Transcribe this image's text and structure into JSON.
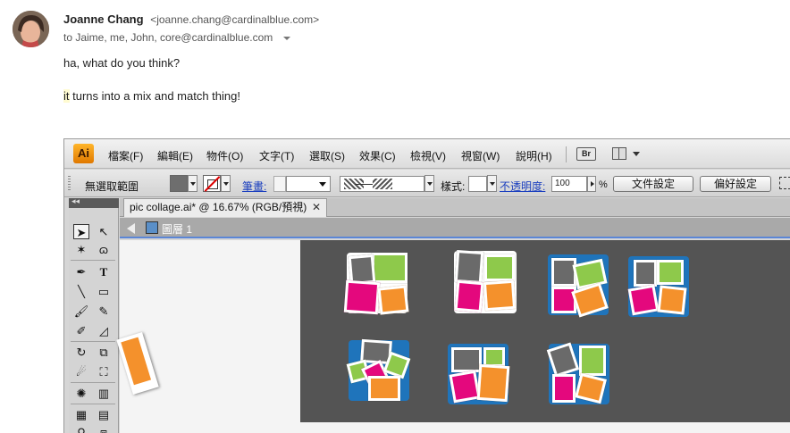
{
  "email": {
    "sender_name": "Joanne Chang",
    "sender_email": "<joanne.chang@cardinalblue.com>",
    "recipients": "to Jaime, me, John, core@cardinalblue.com",
    "line1": "ha, what do you think?",
    "line2_highlight": "it",
    "line2_rest": " turns into a mix and match thing!"
  },
  "illustrator": {
    "logo": "Ai",
    "menu": [
      "檔案(F)",
      "編輯(E)",
      "物件(O)",
      "文字(T)",
      "選取(S)",
      "效果(C)",
      "檢視(V)",
      "視窗(W)",
      "說明(H)"
    ],
    "bridge_button": "Br",
    "control": {
      "selection": "無選取範圍",
      "stroke_label": "筆畫:",
      "style_label": "樣式:",
      "opacity_label": "不透明度:",
      "opacity_value": "100",
      "percent": "%",
      "doc_setup": "文件設定",
      "preferences": "偏好設定"
    },
    "tools_collapse": "◂◂",
    "document_tab": "pic collage.ai* @ 16.67% (RGB/預視)",
    "tab_close": "✕",
    "layer_name": "圖層 1"
  },
  "colors": {
    "tile_blue": "#1f74bb",
    "photo_gray": "#6a6a6a",
    "photo_green": "#8ec94b",
    "photo_pink": "#e4087d",
    "photo_orange": "#f4912c"
  }
}
